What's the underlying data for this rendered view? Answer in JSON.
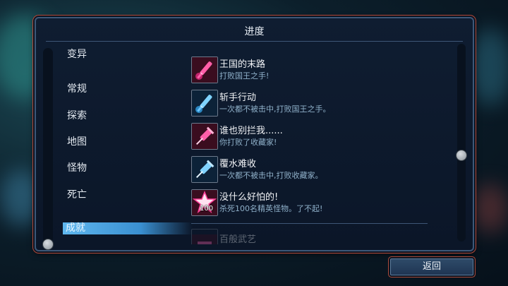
{
  "panel": {
    "title": "进度"
  },
  "categories": [
    {
      "label": "变异",
      "active": false
    },
    {
      "label": "常规",
      "active": false
    },
    {
      "label": "探索",
      "active": false
    },
    {
      "label": "地图",
      "active": false
    },
    {
      "label": "怪物",
      "active": false
    },
    {
      "label": "死亡",
      "active": false
    },
    {
      "label": "成就",
      "active": true
    }
  ],
  "achievements": [
    {
      "name": "王国的末路",
      "desc": "打败国王之手!",
      "icon": "pink-syringe-icon"
    },
    {
      "name": "斩手行动",
      "desc": "一次都不被击中,打败国王之手。",
      "icon": "blue-syringe-icon"
    },
    {
      "name": "谁也别拦我......",
      "desc": "你打败了收藏家!",
      "icon": "pink-syringe-needle-icon"
    },
    {
      "name": "覆水难收",
      "desc": "一次都不被击中,打败收藏家。",
      "icon": "blue-syringe-needle-icon"
    },
    {
      "name": "没什么好怕的!",
      "desc": "杀死100名精英怪物。了不起!",
      "icon": "pink-star-icon",
      "badge": "100"
    },
    {
      "name": "百般武艺",
      "desc": "",
      "icon": "partial-icon"
    }
  ],
  "footer": {
    "back_label": "返回"
  },
  "colors": {
    "accent": "#5fb7ef",
    "frame": "#3c5878",
    "trim": "#b34a3a",
    "desc_text": "#8fb0c9"
  }
}
